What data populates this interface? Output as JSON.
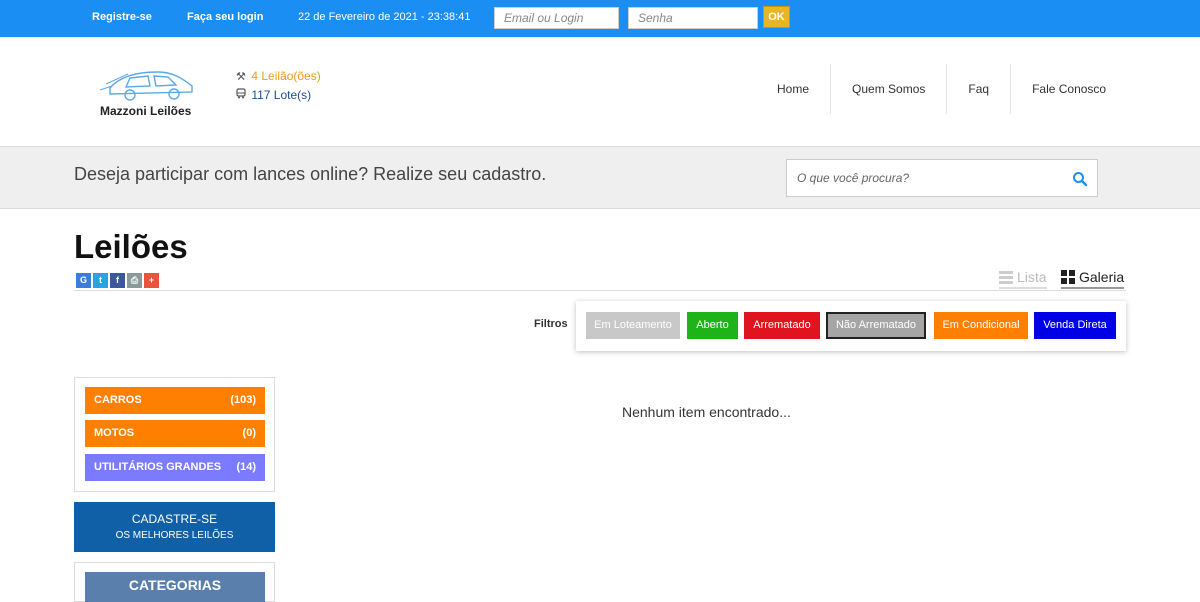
{
  "topbar": {
    "register": "Registre-se",
    "login_link": "Faça seu login",
    "datetime": "22 de Fevereiro de 2021 - 23:38:41",
    "email_placeholder": "Email ou Login",
    "password_placeholder": "Senha",
    "ok_label": "OK"
  },
  "header": {
    "logo_text": "Mazzoni Leilões",
    "auctions": "4 Leilão(ões)",
    "lots": "117 Lote(s)",
    "nav": [
      "Home",
      "Quem Somos",
      "Faq",
      "Fale Conosco"
    ]
  },
  "banner": {
    "message": "Deseja participar com lances online? Realize seu cadastro.",
    "search_placeholder": "O que você procura?"
  },
  "page": {
    "title": "Leilões",
    "view_list": "Lista",
    "view_gallery": "Galeria",
    "share_icons": [
      "google-icon",
      "twitter-icon",
      "facebook-icon",
      "print-icon",
      "plus-icon"
    ]
  },
  "filters": {
    "label": "Filtros",
    "buttons": [
      {
        "label": "Em Loteamento",
        "color": "#c8c8c8"
      },
      {
        "label": "Aberto",
        "color": "#1fb31a"
      },
      {
        "label": "Arrematado",
        "color": "#e0141e"
      },
      {
        "label": "Não Arrematado",
        "color": "#a5a5a5"
      },
      {
        "label": "Em Condicional",
        "color": "#ff8000"
      },
      {
        "label": "Venda Direta",
        "color": "#0000e6"
      }
    ]
  },
  "categories": [
    {
      "name": "CARROS",
      "count": "(103)",
      "color": "#ff8000"
    },
    {
      "name": "MOTOS",
      "count": "(0)",
      "color": "#ff8000"
    },
    {
      "name": "UTILITÁRIOS GRANDES",
      "count": "(14)",
      "color": "#7b7bff"
    }
  ],
  "cadastre": {
    "line1": "CADASTRE-SE",
    "line2": "OS MELHORES LEILÕES"
  },
  "categorias_header": "CATEGORIAS",
  "empty_message": "Nenhum item encontrado..."
}
